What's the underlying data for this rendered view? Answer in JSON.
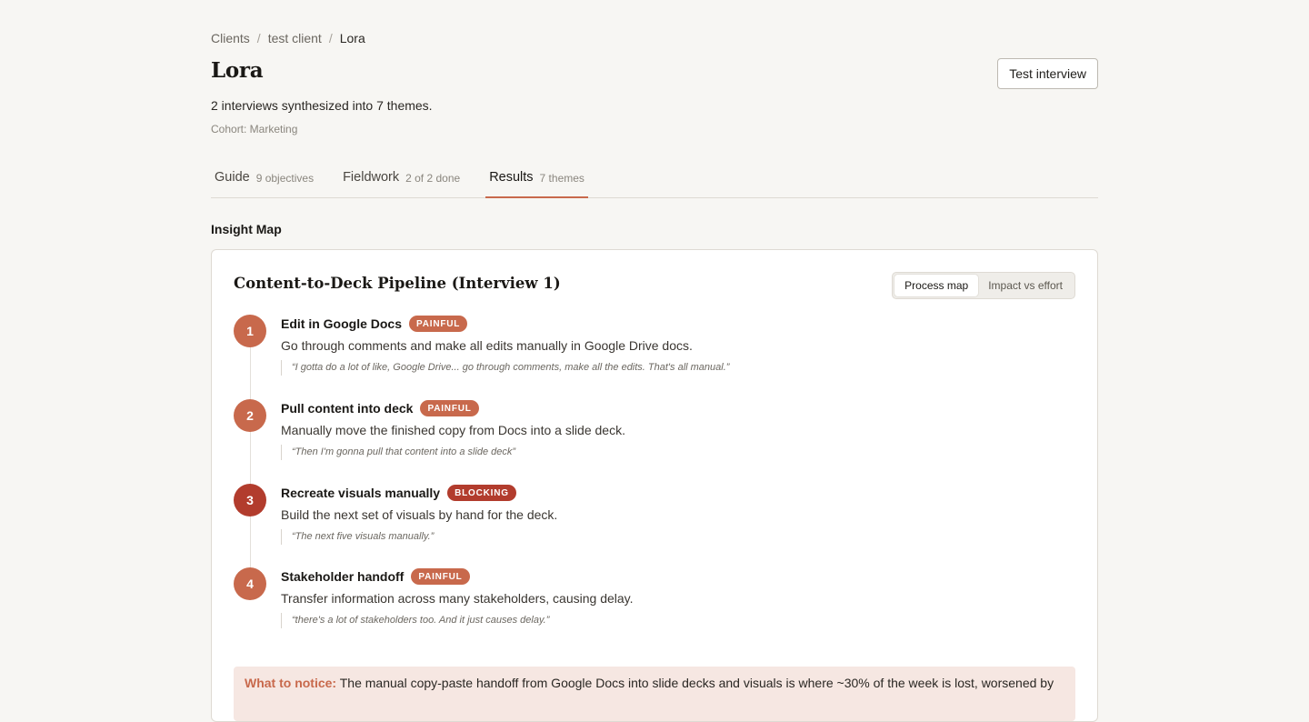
{
  "breadcrumb": [
    "Clients",
    "test client",
    "Lora"
  ],
  "breadcrumb_sep": "/",
  "page": {
    "title": "Lora",
    "test_button": "Test interview",
    "subtitle": "2 interviews synthesized into 7 themes.",
    "cohort": "Cohort: Marketing"
  },
  "tabs": [
    {
      "label": "Guide",
      "count": "9 objectives",
      "active": false
    },
    {
      "label": "Fieldwork",
      "count": "2 of 2 done",
      "active": false
    },
    {
      "label": "Results",
      "count": "7 themes",
      "active": true
    }
  ],
  "section_heading": "Insight Map",
  "card": {
    "title": "Content-to-Deck Pipeline (Interview 1)",
    "view_toggle": [
      {
        "label": "Process map",
        "selected": true
      },
      {
        "label": "Impact vs effort",
        "selected": false
      }
    ],
    "steps": [
      {
        "number": "1",
        "name": "Edit in Google Docs",
        "badge": "PAINFUL",
        "description": "Go through comments and make all edits manually in Google Drive docs.",
        "quote": "“I gotta do a lot of like, Google Drive... go through comments, make all the edits. That's all manual.”"
      },
      {
        "number": "2",
        "name": "Pull content into deck",
        "badge": "PAINFUL",
        "description": "Manually move the finished copy from Docs into a slide deck.",
        "quote": "“Then I'm gonna pull that content into a slide deck”"
      },
      {
        "number": "3",
        "name": "Recreate visuals manually",
        "badge": "BLOCKING",
        "description": "Build the next set of visuals by hand for the deck.",
        "quote": "“The next five visuals manually.”"
      },
      {
        "number": "4",
        "name": "Stakeholder handoff",
        "badge": "PAINFUL",
        "description": "Transfer information across many stakeholders, causing delay.",
        "quote": "“there's a lot of stakeholders too. And it just causes delay.”"
      }
    ],
    "notice": {
      "lead": "What to notice:",
      "text": "The manual copy-paste handoff from Google Docs into slide decks and visuals is where ~30% of the week is lost, worsened by"
    }
  },
  "colors": {
    "accent": "#c8694c",
    "painful": "#c8694c",
    "blocking": "#b23c2d",
    "background": "#f7f6f3",
    "notice_bg": "#f6e7e2"
  }
}
